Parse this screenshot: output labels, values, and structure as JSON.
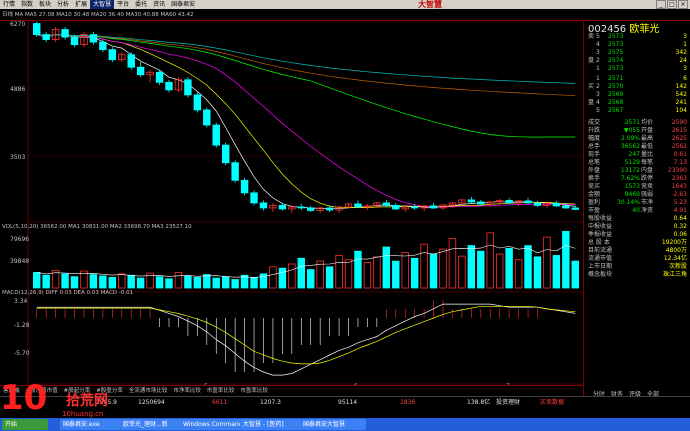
{
  "menu": [
    "行情",
    "指数",
    "板块",
    "分析",
    "扩展",
    "大智慧",
    "平台",
    "委托",
    "资讯",
    "国泰君安"
  ],
  "menu_highlight_index": 5,
  "logo": "大智慧",
  "stock": {
    "code": "002456",
    "name": "欧菲光"
  },
  "y_axis": {
    "top": "6270",
    "mid": "4886",
    "low": "3503"
  },
  "vol_axis": {
    "top": "79696",
    "mid": "39848"
  },
  "macd_axis": {
    "top": "3.34",
    "mid": "-1.28",
    "low": "-5.70"
  },
  "legend_price": "日线 MA MA5 27.08 MA10 30.48 MA20 36.40 MA30 40.88 MA60 43.42",
  "legend_vol": "VOL(5,10,20)  36562.00 MA1 30831.00 MA2 33698.70 MA3 23527.10",
  "legend_macd": "MACD(12,26,9) DIFF 0.03 DEA 0.03 MACD -0.01",
  "x_labels": [
    "5",
    "6",
    "7"
  ],
  "sell_book": [
    {
      "label": "卖",
      "level": "5",
      "price": "2573",
      "vol": "3"
    },
    {
      "label": "",
      "level": "4",
      "price": "2573",
      "vol": "1"
    },
    {
      "label": "",
      "level": "3",
      "price": "2575",
      "vol": "342"
    },
    {
      "label": "盘",
      "level": "2",
      "price": "2574",
      "vol": "24"
    },
    {
      "label": "",
      "level": "1",
      "price": "2573",
      "vol": "3"
    }
  ],
  "buy_book": [
    {
      "label": "",
      "level": "1",
      "price": "2571",
      "vol": "6"
    },
    {
      "label": "买",
      "level": "2",
      "price": "2570",
      "vol": "142"
    },
    {
      "label": "",
      "level": "3",
      "price": "2569",
      "vol": "542"
    },
    {
      "label": "盘",
      "level": "4",
      "price": "2568",
      "vol": "241"
    },
    {
      "label": "",
      "level": "5",
      "price": "2567",
      "vol": "104"
    }
  ],
  "stats": [
    {
      "k1": "成交",
      "v1": "2571",
      "k2": "均价",
      "v2": "2590"
    },
    {
      "k1": "升跌",
      "v1": "▼055",
      "k2": "开盘",
      "v2": "2615"
    },
    {
      "k1": "幅度",
      "v1": "2.09%",
      "k2": "最高",
      "v2": "2625"
    },
    {
      "k1": "总手",
      "v1": "36562",
      "k2": "最低",
      "v2": "2562"
    },
    {
      "k1": "现手",
      "v1": "247",
      "k2": "量比",
      "v2": "0.61"
    },
    {
      "k1": "总笔",
      "v1": "5129",
      "k2": "每笔",
      "v2": "7.13"
    },
    {
      "k1": "外盘",
      "v1": "13172",
      "k2": "内盘",
      "v2": "23390"
    },
    {
      "k1": "换手",
      "v1": "7.62%",
      "k2": "跌停",
      "v2": "2363"
    },
    {
      "k1": "竞买",
      "v1": "1573",
      "k2": "竞卖",
      "v2": "1643"
    },
    {
      "k1": "金额",
      "v1": "9469",
      "k2": "强弱",
      "v2": "-2.63"
    },
    {
      "k1": "盈利",
      "v1": "30.14%",
      "k2": "市净",
      "v2": "5.23"
    },
    {
      "k1": "市盈",
      "v1": "40",
      "k2": "净资",
      "v2": "4.91"
    }
  ],
  "fin": [
    {
      "k": "每股收益",
      "v": "0.64"
    },
    {
      "k": "中报收益",
      "v": "0.32"
    },
    {
      "k": "季报收益",
      "v": "0.06"
    },
    {
      "k": "总 股 本",
      "v": "19200万"
    },
    {
      "k": "目前流通",
      "v": "4800万"
    },
    {
      "k": "流通市值",
      "v": "12.34亿"
    },
    {
      "k": "上市日期",
      "v": "次新股"
    },
    {
      "k": "概念板块",
      "v": "珠江三角"
    }
  ],
  "bottom_tabs": [
    "客户端",
    "#股净值市值",
    "#股起分率",
    "#股盈分率",
    "全流通市场比较",
    "市净率比较",
    "市盈率比较",
    "市盈率比较"
  ],
  "panel_tabs": [
    "分时",
    "财务",
    "评级",
    "全部"
  ],
  "status": [
    {
      "v": "1285.9",
      "x": 96
    },
    {
      "v": "1250694",
      "x": 138
    },
    {
      "v": "6611",
      "x": 212
    },
    {
      "v": "1207.3",
      "x": 260
    },
    {
      "v": "95114",
      "x": 338
    },
    {
      "v": "1836",
      "x": 400
    },
    {
      "v": "138.8亿",
      "x": 467
    },
    {
      "v": "投资理财",
      "x": 496
    },
    {
      "v": "买卖数据",
      "x": 540
    }
  ],
  "taskbar": [
    "开始",
    "国泰君安.exe",
    "欧菲光_理财...新",
    "Windows Commander 5.",
    "大智慧 - [医药]",
    "国泰君安大智慧"
  ],
  "watermark": {
    "num": "10",
    "site": "拾荒网",
    "url": "10huang.cn"
  },
  "chart_data": {
    "type": "candlestick",
    "ylim": [
      2400,
      6300
    ],
    "candles": [
      [
        6270,
        6300,
        6000,
        6050
      ],
      [
        6050,
        6100,
        5900,
        5950
      ],
      [
        5950,
        6200,
        5900,
        6150
      ],
      [
        6150,
        6200,
        5950,
        6000
      ],
      [
        6000,
        6050,
        5800,
        5850
      ],
      [
        5850,
        6100,
        5800,
        6050
      ],
      [
        6050,
        6100,
        5850,
        5900
      ],
      [
        5900,
        5950,
        5700,
        5750
      ],
      [
        5750,
        5800,
        5500,
        5550
      ],
      [
        5550,
        5700,
        5500,
        5650
      ],
      [
        5650,
        5700,
        5350,
        5400
      ],
      [
        5400,
        5500,
        5200,
        5250
      ],
      [
        5250,
        5350,
        5100,
        5300
      ],
      [
        5300,
        5350,
        5050,
        5100
      ],
      [
        5100,
        5150,
        4900,
        4950
      ],
      [
        4950,
        5200,
        4900,
        5150
      ],
      [
        5150,
        5200,
        4800,
        4850
      ],
      [
        4850,
        4900,
        4500,
        4550
      ],
      [
        4550,
        4600,
        4200,
        4250
      ],
      [
        4250,
        4300,
        3800,
        3850
      ],
      [
        3850,
        3900,
        3450,
        3500
      ],
      [
        3500,
        3550,
        3100,
        3150
      ],
      [
        3150,
        3200,
        2850,
        2900
      ],
      [
        2900,
        2950,
        2650,
        2700
      ],
      [
        2700,
        2750,
        2550,
        2600
      ],
      [
        2600,
        2700,
        2520,
        2650
      ],
      [
        2650,
        2700,
        2550,
        2580
      ],
      [
        2580,
        2650,
        2500,
        2620
      ],
      [
        2620,
        2680,
        2560,
        2600
      ],
      [
        2600,
        2640,
        2520,
        2550
      ],
      [
        2550,
        2620,
        2500,
        2600
      ],
      [
        2600,
        2650,
        2520,
        2560
      ],
      [
        2560,
        2640,
        2500,
        2620
      ],
      [
        2620,
        2700,
        2580,
        2680
      ],
      [
        2680,
        2750,
        2600,
        2620
      ],
      [
        2620,
        2680,
        2560,
        2640
      ],
      [
        2640,
        2720,
        2600,
        2700
      ],
      [
        2700,
        2760,
        2620,
        2650
      ],
      [
        2650,
        2700,
        2560,
        2580
      ],
      [
        2580,
        2650,
        2520,
        2620
      ],
      [
        2620,
        2680,
        2560,
        2600
      ],
      [
        2600,
        2660,
        2540,
        2640
      ],
      [
        2640,
        2700,
        2580,
        2600
      ],
      [
        2600,
        2680,
        2560,
        2660
      ],
      [
        2660,
        2720,
        2600,
        2700
      ],
      [
        2700,
        2780,
        2640,
        2760
      ],
      [
        2760,
        2820,
        2680,
        2720
      ],
      [
        2720,
        2760,
        2640,
        2680
      ],
      [
        2680,
        2740,
        2620,
        2720
      ],
      [
        2720,
        2780,
        2660,
        2750
      ],
      [
        2750,
        2800,
        2680,
        2700
      ],
      [
        2700,
        2760,
        2640,
        2740
      ],
      [
        2740,
        2800,
        2680,
        2700
      ],
      [
        2700,
        2740,
        2620,
        2650
      ],
      [
        2650,
        2720,
        2600,
        2690
      ],
      [
        2690,
        2740,
        2620,
        2640
      ],
      [
        2640,
        2700,
        2580,
        2600
      ],
      [
        2600,
        2650,
        2560,
        2571
      ]
    ],
    "volumes": [
      22,
      18,
      25,
      20,
      16,
      24,
      19,
      17,
      15,
      20,
      18,
      14,
      21,
      16,
      13,
      22,
      17,
      15,
      19,
      14,
      16,
      12,
      18,
      15,
      20,
      30,
      28,
      34,
      42,
      26,
      38,
      30,
      46,
      40,
      52,
      36,
      44,
      58,
      38,
      50,
      42,
      62,
      48,
      55,
      70,
      45,
      60,
      52,
      78,
      48,
      56,
      40,
      60,
      44,
      72,
      46,
      80,
      38
    ],
    "macd_hist": [
      1,
      1,
      1,
      1,
      1,
      1,
      1,
      1,
      1,
      1,
      1,
      1,
      1,
      -1,
      -1,
      -1,
      -2,
      -2,
      -3,
      -4,
      -5,
      -6,
      -6,
      -6,
      -5,
      -5,
      -4,
      -4,
      -3,
      -3,
      -3,
      -2,
      -2,
      -2,
      -1,
      -1,
      -1,
      1,
      1,
      1,
      1,
      1,
      2,
      2,
      1,
      1,
      1,
      1,
      1,
      1,
      1,
      1,
      1,
      1,
      0,
      0,
      0,
      0
    ]
  }
}
